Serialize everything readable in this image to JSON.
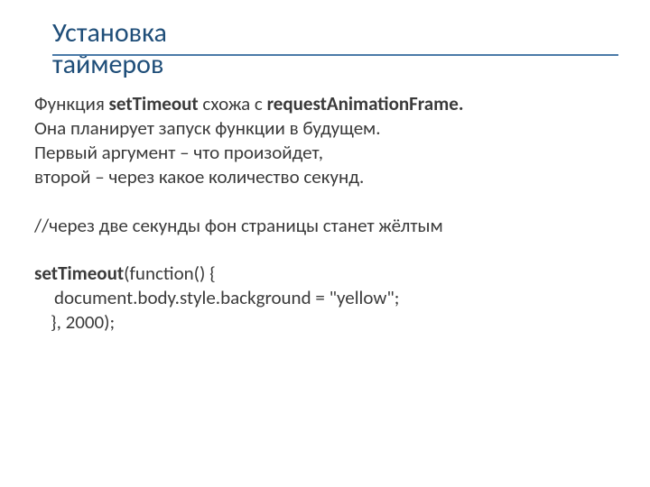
{
  "title": {
    "line1": "Установка",
    "line2": "таймеров"
  },
  "body": {
    "p1_a": "Функция ",
    "p1_b": "setTimeout",
    "p1_c": " схожа с ",
    "p1_d": "requestAnimationFrame.",
    "p2": "Она планирует запуск функции в будущем.",
    "p3": "Первый аргумент – что произойдет,",
    "p4": "второй – через какое количество секунд.",
    "comment": "//через две секунды фон страницы станет жёлтым",
    "code1_a": "setTimeout",
    "code1_b": "(function() {",
    "code2": "document.body.style.background = \"yellow\";",
    "code3": "}, 2000);"
  }
}
